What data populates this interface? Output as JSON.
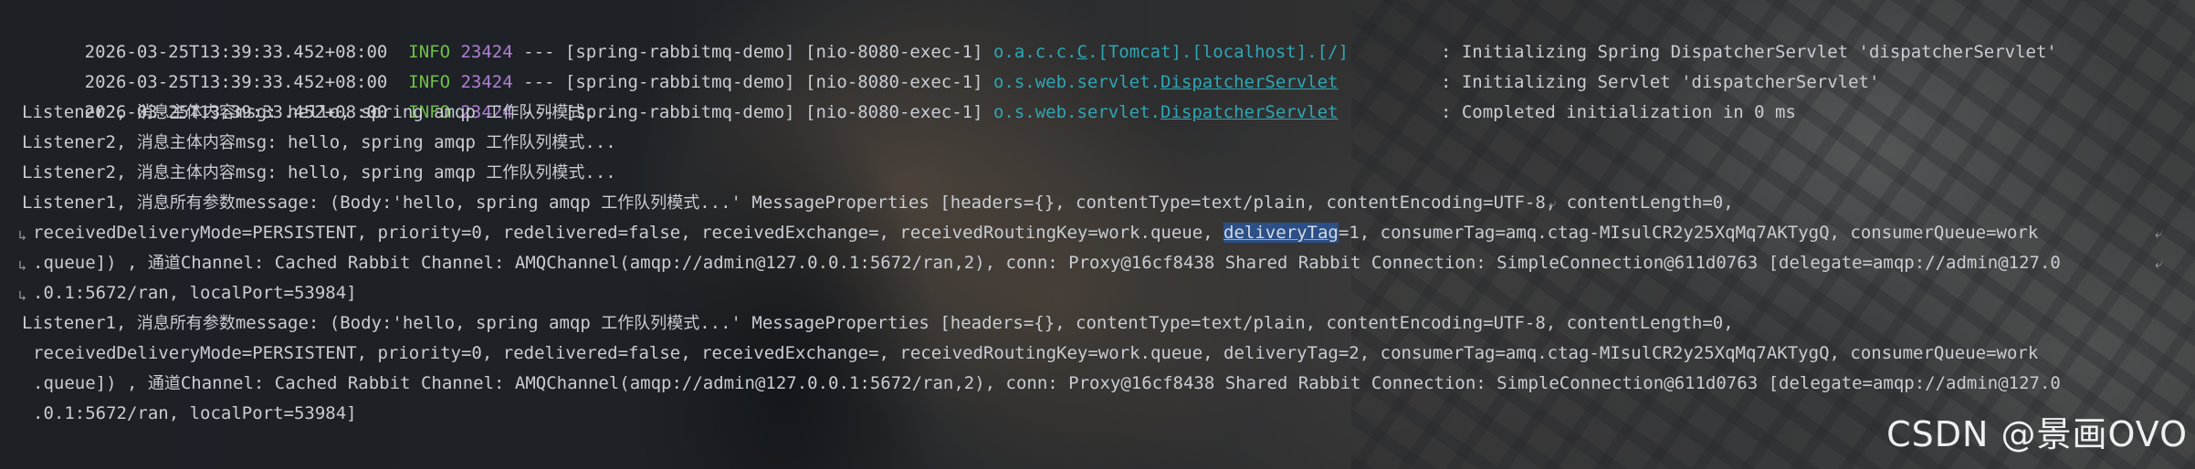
{
  "header_lines": [
    {
      "timestamp": "2026-03-25T13:39:33.452+08:00",
      "level": "INFO",
      "pid": "23424",
      "sep": "---",
      "app": "[spring-rabbitmq-demo]",
      "thread": "[nio-8080-exec-1]",
      "logger_a": "o.a.c.c.",
      "logger_b": "C",
      "logger_c": ".[Tomcat].[localhost].[/]",
      "message": ": Initializing Spring DispatcherServlet 'dispatcherServlet'"
    },
    {
      "timestamp": "2026-03-25T13:39:33.452+08:00",
      "level": "INFO",
      "pid": "23424",
      "sep": "---",
      "app": "[spring-rabbitmq-demo]",
      "thread": "[nio-8080-exec-1]",
      "logger_a": "o.s.web.servlet.",
      "logger_b": "DispatcherServlet",
      "logger_c": "",
      "message": ": Initializing Servlet 'dispatcherServlet'"
    },
    {
      "timestamp": "2026-03-25T13:39:33.452+08:00",
      "level": "INFO",
      "pid": "23424",
      "sep": "---",
      "app": "[spring-rabbitmq-demo]",
      "thread": "[nio-8080-exec-1]",
      "logger_a": "o.s.web.servlet.",
      "logger_b": "DispatcherServlet",
      "logger_c": "",
      "message": ": Completed initialization in 0 ms"
    }
  ],
  "listener2_lines": [
    {
      "prefix": "Listener2, ",
      "cjk_a": "消息主体内容",
      "mid": "msg: hello, spring amqp ",
      "cjk_b": "工作队列模式",
      "suffix": "..."
    },
    {
      "prefix": "Listener2, ",
      "cjk_a": "消息主体内容",
      "mid": "msg: hello, spring amqp ",
      "cjk_b": "工作队列模式",
      "suffix": "..."
    },
    {
      "prefix": "Listener2, ",
      "cjk_a": "消息主体内容",
      "mid": "msg: hello, spring amqp ",
      "cjk_b": "工作队列模式",
      "suffix": "..."
    }
  ],
  "listener1_block1": {
    "l1_prefix": "Listener1, ",
    "l1_cjk_a": "消息所有参数",
    "l1_mid": "message: (Body:'hello, spring amqp ",
    "l1_cjk_b": "工作队列模式",
    "l1_rest": "...' MessageProperties [headers={}, contentType=text/plain, contentEncoding=UTF-8, contentLength=0, ",
    "l2_pre": "receivedDeliveryMode=PERSISTENT, priority=0, redelivered=false, receivedExchange=, receivedRoutingKey=work.queue, ",
    "l2_hl": "deliveryTag",
    "l2_post": "=1, consumerTag=amq.ctag-MIsulCR2y25XqMq7AKTygQ, consumerQueue=work",
    "l3_pre": ".queue]) , ",
    "l3_cjk": "通道",
    "l3_post": "Channel: Cached Rabbit Channel: AMQChannel(amqp://admin@127.0.0.1:5672/ran,2), conn: Proxy@16cf8438 Shared Rabbit Connection: SimpleConnection@611d0763 [delegate=amqp://admin@127.0",
    "l4": ".0.1:5672/ran, localPort=53984]"
  },
  "listener1_block2": {
    "l1_prefix": "Listener1, ",
    "l1_cjk_a": "消息所有参数",
    "l1_mid": "message: (Body:'hello, spring amqp ",
    "l1_cjk_b": "工作队列模式",
    "l1_rest": "...' MessageProperties [headers={}, contentType=text/plain, contentEncoding=UTF-8, contentLength=0,",
    "l2": "receivedDeliveryMode=PERSISTENT, priority=0, redelivered=false, receivedExchange=, receivedRoutingKey=work.queue, deliveryTag=2, consumerTag=amq.ctag-MIsulCR2y25XqMq7AKTygQ, consumerQueue=work",
    "l3_pre": ".queue]) , ",
    "l3_cjk": "通道",
    "l3_post": "Channel: Cached Rabbit Channel: AMQChannel(amqp://admin@127.0.0.1:5672/ran,2), conn: Proxy@16cf8438 Shared Rabbit Connection: SimpleConnection@611d0763 [delegate=amqp://admin@127.0",
    "l4": ".0.1:5672/ran, localPort=53984]"
  },
  "watermark": "CSDN @景画OVO",
  "icons": {
    "soft_wrap_end": "soft-wrap-arrow-icon",
    "soft_wrap_start": "soft-wrap-continuation-icon"
  },
  "colors": {
    "info_level": "#6fbf4a",
    "pid": "#b07fd6",
    "logger": "#2fa6b3",
    "selection": "#2b4f86"
  }
}
